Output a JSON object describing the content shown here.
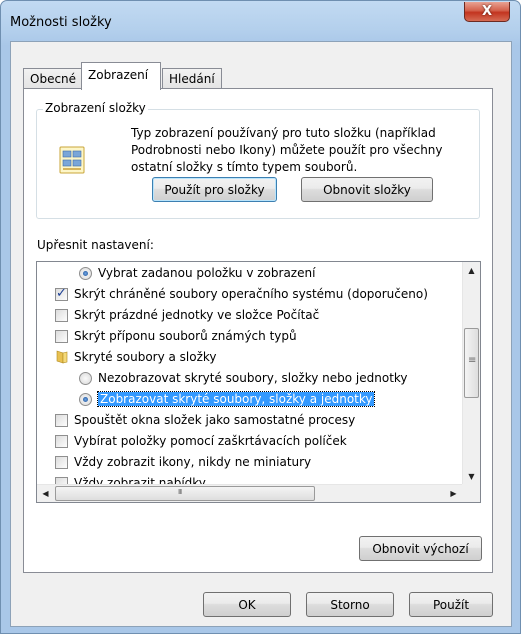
{
  "window": {
    "title": "Možnosti složky",
    "close_label": "X"
  },
  "tabs": [
    {
      "label": "Obecné",
      "active": false
    },
    {
      "label": "Zobrazení",
      "active": true
    },
    {
      "label": "Hledání",
      "active": false
    }
  ],
  "folder_view": {
    "group_label": "Zobrazení složky",
    "description": "Typ zobrazení používaný pro tuto složku (například Podrobnosti nebo Ikony) můžete použít pro všechny ostatní složky s tímto typem souborů.",
    "apply_button": "Použít pro složky",
    "reset_button": "Obnovit složky"
  },
  "advanced": {
    "label": "Upřesnit nastavení:",
    "items": [
      {
        "type": "radio",
        "checked": true,
        "indent": 1,
        "label": "Vybrat zadanou položku v zobrazení"
      },
      {
        "type": "checkbox",
        "checked": true,
        "indent": 0,
        "label": "Skrýt chráněné soubory operačního systému (doporučeno)"
      },
      {
        "type": "checkbox",
        "checked": false,
        "indent": 0,
        "label": "Skrýt prázdné jednotky ve složce Počítač"
      },
      {
        "type": "checkbox",
        "checked": false,
        "indent": 0,
        "label": "Skrýt příponu souborů známých typů"
      },
      {
        "type": "folder",
        "indent": 0,
        "label": "Skryté soubory a složky"
      },
      {
        "type": "radio",
        "checked": false,
        "indent": 1,
        "label": "Nezobrazovat skryté soubory, složky nebo jednotky"
      },
      {
        "type": "radio",
        "checked": true,
        "indent": 1,
        "label": "Zobrazovat skryté soubory, složky a jednotky",
        "selected": true
      },
      {
        "type": "checkbox",
        "checked": false,
        "indent": 0,
        "label": "Spouštět okna složek jako samostatné procesy"
      },
      {
        "type": "checkbox",
        "checked": false,
        "indent": 0,
        "label": "Vybírat položky pomocí zaškrtávacích políček"
      },
      {
        "type": "checkbox",
        "checked": false,
        "indent": 0,
        "label": "Vždy zobrazit ikony, nikdy ne miniatury"
      },
      {
        "type": "checkbox",
        "checked": false,
        "indent": 0,
        "label": "Vždy zobrazit nabídky"
      }
    ],
    "restore_defaults": "Obnovit výchozí"
  },
  "footer": {
    "ok": "OK",
    "cancel": "Storno",
    "apply": "Použít"
  },
  "colors": {
    "selection": "#3399ff",
    "close_button": "#c3341f"
  }
}
